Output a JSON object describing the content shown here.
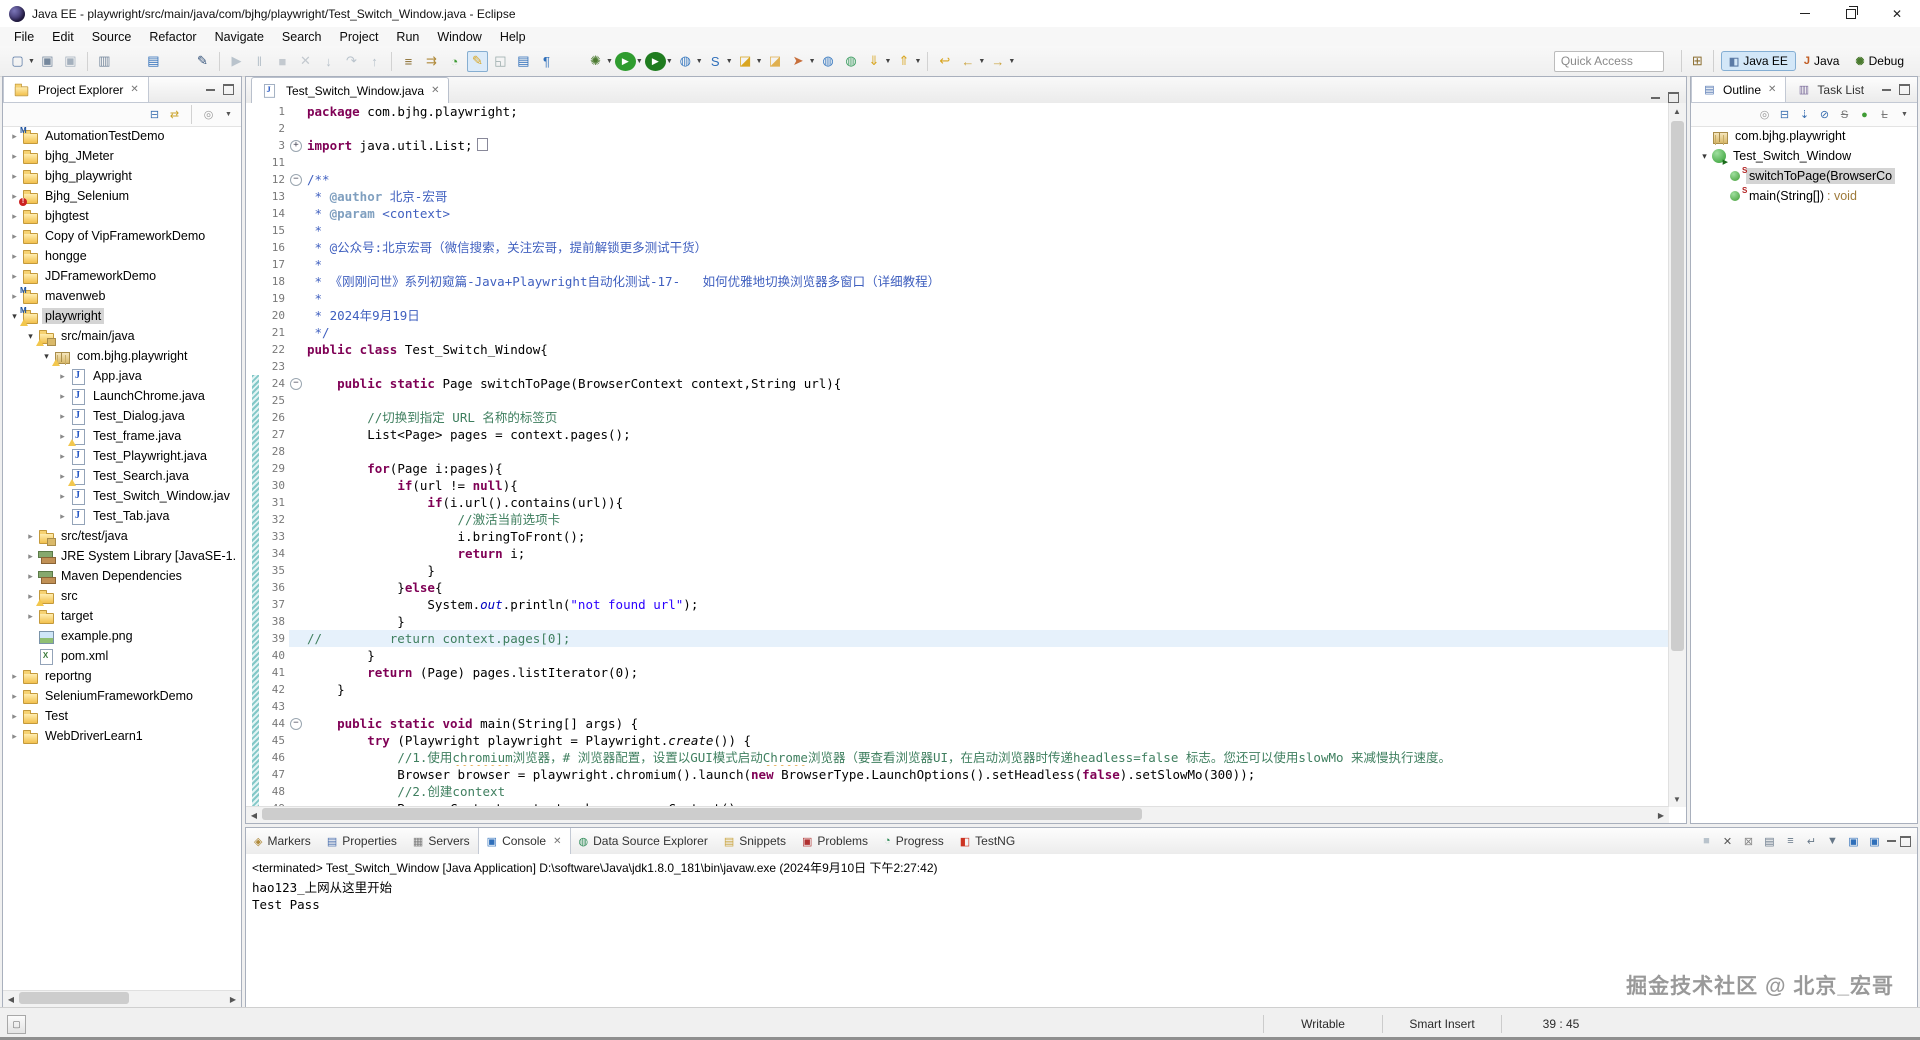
{
  "window": {
    "title": "Java EE - playwright/src/main/java/com/bjhg/playwright/Test_Switch_Window.java - Eclipse"
  },
  "menubar": {
    "items": [
      "File",
      "Edit",
      "Source",
      "Refactor",
      "Navigate",
      "Search",
      "Project",
      "Run",
      "Window",
      "Help"
    ]
  },
  "toolbar": {
    "quick_access_label": "Quick Access",
    "items": [
      "new-wizard*",
      "save",
      "save-all",
      "|",
      "print",
      "~",
      "open-element",
      "~",
      "mark-pen",
      "|",
      "resume",
      "suspend",
      "terminate",
      "disconnect",
      "step-into",
      "step-over",
      "step-return",
      "|",
      "step-filters",
      "clear-marks",
      "coverage-count",
      "highlighter!",
      "link-pair",
      "show-selected-element",
      "show-whitespace",
      "~",
      "debug*",
      "run*",
      "coverage*",
      "new-web-service*",
      "soap-monitor*",
      "open-folder*",
      "import-folder",
      "deploy*",
      "web-browser",
      "user-site",
      "download*",
      "upload*",
      "|",
      "last-edit-location",
      "back*",
      "forward*"
    ],
    "open_perspective_icon": "open-perspective",
    "perspectives": [
      {
        "label": "Java EE",
        "icon": "persp-javaee",
        "active": true
      },
      {
        "label": "Java",
        "icon": "persp-java",
        "active": false
      },
      {
        "label": "Debug",
        "icon": "persp-debug",
        "active": false
      }
    ]
  },
  "project_explorer": {
    "tab": "Project Explorer",
    "toolbar_icons": [
      "collapse-all",
      "link-with-editor",
      "|",
      "focus",
      "view-menu"
    ],
    "items": [
      {
        "d": 0,
        "a": ">",
        "icon": "fold",
        "badges": [
          "M"
        ],
        "label": "AutomationTestDemo"
      },
      {
        "d": 0,
        "a": ">",
        "icon": "fold",
        "badges": [],
        "label": "bjhg_JMeter"
      },
      {
        "d": 0,
        "a": ">",
        "icon": "fold",
        "badges": [],
        "label": "bjhg_playwright"
      },
      {
        "d": 0,
        "a": ">",
        "icon": "fold",
        "badges": [
          "E"
        ],
        "label": "Bjhg_Selenium"
      },
      {
        "d": 0,
        "a": ">",
        "icon": "fold",
        "badges": [],
        "label": "bjhgtest"
      },
      {
        "d": 0,
        "a": ">",
        "icon": "fold",
        "badges": [],
        "label": "Copy of VipFrameworkDemo"
      },
      {
        "d": 0,
        "a": ">",
        "icon": "fold",
        "badges": [],
        "label": "hongge"
      },
      {
        "d": 0,
        "a": ">",
        "icon": "fold",
        "badges": [],
        "label": "JDFrameworkDemo"
      },
      {
        "d": 0,
        "a": ">",
        "icon": "fold",
        "badges": [
          "M"
        ],
        "label": "mavenweb"
      },
      {
        "d": 0,
        "a": "v",
        "icon": "fold",
        "badges": [
          "M",
          "W"
        ],
        "label": "playwright",
        "sel": true
      },
      {
        "d": 1,
        "a": "v",
        "icon": "srcfold",
        "badges": [
          "W"
        ],
        "label": "src/main/java"
      },
      {
        "d": 2,
        "a": "v",
        "icon": "pkg",
        "badges": [
          "W"
        ],
        "label": "com.bjhg.playwright"
      },
      {
        "d": 3,
        "a": ">",
        "icon": "jf",
        "badges": [],
        "label": "App.java"
      },
      {
        "d": 3,
        "a": ">",
        "icon": "jf",
        "badges": [],
        "label": "LaunchChrome.java"
      },
      {
        "d": 3,
        "a": ">",
        "icon": "jf",
        "badges": [],
        "label": "Test_Dialog.java"
      },
      {
        "d": 3,
        "a": ">",
        "icon": "jf",
        "badges": [
          "W"
        ],
        "label": "Test_frame.java"
      },
      {
        "d": 3,
        "a": ">",
        "icon": "jf",
        "badges": [],
        "label": "Test_Playwright.java"
      },
      {
        "d": 3,
        "a": ">",
        "icon": "jf",
        "badges": [
          "W"
        ],
        "label": "Test_Search.java"
      },
      {
        "d": 3,
        "a": ">",
        "icon": "jf",
        "badges": [],
        "label": "Test_Switch_Window.jav"
      },
      {
        "d": 3,
        "a": ">",
        "icon": "jf",
        "badges": [],
        "label": "Test_Tab.java"
      },
      {
        "d": 1,
        "a": ">",
        "icon": "srcfold",
        "badges": [],
        "label": "src/test/java"
      },
      {
        "d": 1,
        "a": ">",
        "icon": "lib",
        "badges": [],
        "label": "JRE System Library [JavaSE-1."
      },
      {
        "d": 1,
        "a": ">",
        "icon": "lib",
        "badges": [],
        "label": "Maven Dependencies"
      },
      {
        "d": 1,
        "a": ">",
        "icon": "fold",
        "badges": [
          "W"
        ],
        "label": "src"
      },
      {
        "d": 1,
        "a": ">",
        "icon": "fold",
        "badges": [],
        "label": "target"
      },
      {
        "d": 1,
        "a": "",
        "icon": "img",
        "badges": [],
        "label": "example.png"
      },
      {
        "d": 1,
        "a": "",
        "icon": "xml",
        "badges": [],
        "label": "pom.xml"
      },
      {
        "d": 0,
        "a": ">",
        "icon": "fold",
        "badges": [],
        "label": "reportng"
      },
      {
        "d": 0,
        "a": ">",
        "icon": "fold",
        "badges": [],
        "label": "SeleniumFrameworkDemo"
      },
      {
        "d": 0,
        "a": ">",
        "icon": "fold",
        "badges": [],
        "label": "Test"
      },
      {
        "d": 0,
        "a": ">",
        "icon": "fold",
        "badges": [],
        "label": "WebDriverLearn1"
      }
    ]
  },
  "editor": {
    "tab_label": "Test_Switch_Window.java",
    "lines": [
      {
        "n": 1,
        "segs": [
          [
            "k",
            "package"
          ],
          [
            "p",
            " com.bjhg.playwright;"
          ]
        ]
      },
      {
        "n": 2,
        "segs": []
      },
      {
        "n": 3,
        "fold": "+",
        "segs": [
          [
            "k",
            "import"
          ],
          [
            "p",
            " java.util.List;"
          ],
          [
            "fb",
            ""
          ]
        ]
      },
      {
        "n": 11,
        "segs": []
      },
      {
        "n": 12,
        "fold": "-",
        "segs": [
          [
            "d",
            "/**"
          ]
        ]
      },
      {
        "n": 13,
        "segs": [
          [
            "d",
            " * "
          ],
          [
            "dt",
            "@author"
          ],
          [
            "d",
            " 北京-宏哥"
          ]
        ]
      },
      {
        "n": 14,
        "segs": [
          [
            "d",
            " * "
          ],
          [
            "dt",
            "@param"
          ],
          [
            "d",
            " <context>"
          ]
        ]
      },
      {
        "n": 15,
        "segs": [
          [
            "d",
            " *"
          ]
        ]
      },
      {
        "n": 16,
        "segs": [
          [
            "d",
            " * @公众号:北京宏哥（微信搜索，关注宏哥，提前解锁更多测试干货）"
          ]
        ]
      },
      {
        "n": 17,
        "segs": [
          [
            "d",
            " *"
          ]
        ]
      },
      {
        "n": 18,
        "segs": [
          [
            "d",
            " * 《刚刚问世》系列初窥篇-Java+Playwright自动化测试-17-   如何优雅地切换浏览器多窗口（详细教程）"
          ]
        ]
      },
      {
        "n": 19,
        "segs": [
          [
            "d",
            " *"
          ]
        ]
      },
      {
        "n": 20,
        "segs": [
          [
            "d",
            " * 2024年9月19日"
          ]
        ]
      },
      {
        "n": 21,
        "segs": [
          [
            "d",
            " */"
          ]
        ]
      },
      {
        "n": 22,
        "segs": [
          [
            "k",
            "public class"
          ],
          [
            "p",
            " Test_Switch_Window{"
          ]
        ]
      },
      {
        "n": 23,
        "segs": []
      },
      {
        "n": 24,
        "fold": "-",
        "ch": 1,
        "segs": [
          [
            "p",
            "    "
          ],
          [
            "k",
            "public static"
          ],
          [
            "p",
            " Page switchToPage(BrowserContext context,String url){"
          ]
        ]
      },
      {
        "n": 25,
        "ch": 1,
        "segs": []
      },
      {
        "n": 26,
        "ch": 1,
        "segs": [
          [
            "p",
            "        "
          ],
          [
            "c",
            "//切换到指定 URL 名称的标签页"
          ]
        ]
      },
      {
        "n": 27,
        "ch": 1,
        "segs": [
          [
            "p",
            "        List<Page> pages = context.pages();"
          ]
        ]
      },
      {
        "n": 28,
        "ch": 1,
        "segs": []
      },
      {
        "n": 29,
        "ch": 1,
        "segs": [
          [
            "p",
            "        "
          ],
          [
            "k",
            "for"
          ],
          [
            "p",
            "(Page i:pages){"
          ]
        ]
      },
      {
        "n": 30,
        "ch": 1,
        "segs": [
          [
            "p",
            "            "
          ],
          [
            "k",
            "if"
          ],
          [
            "p",
            "(url != "
          ],
          [
            "k",
            "null"
          ],
          [
            "p",
            "){"
          ]
        ]
      },
      {
        "n": 31,
        "ch": 1,
        "segs": [
          [
            "p",
            "                "
          ],
          [
            "k",
            "if"
          ],
          [
            "p",
            "(i.url().contains(url)){"
          ]
        ]
      },
      {
        "n": 32,
        "ch": 1,
        "segs": [
          [
            "p",
            "                    "
          ],
          [
            "c",
            "//激活当前选项卡"
          ]
        ]
      },
      {
        "n": 33,
        "ch": 1,
        "segs": [
          [
            "p",
            "                    i.bringToFront();"
          ]
        ]
      },
      {
        "n": 34,
        "ch": 1,
        "segs": [
          [
            "p",
            "                    "
          ],
          [
            "k",
            "return"
          ],
          [
            "p",
            " i;"
          ]
        ]
      },
      {
        "n": 35,
        "ch": 1,
        "segs": [
          [
            "p",
            "                }"
          ]
        ]
      },
      {
        "n": 36,
        "ch": 1,
        "segs": [
          [
            "p",
            "            }"
          ],
          [
            "k",
            "else"
          ],
          [
            "p",
            "{"
          ]
        ]
      },
      {
        "n": 37,
        "ch": 1,
        "segs": [
          [
            "p",
            "                System."
          ],
          [
            "f",
            "out"
          ],
          [
            "p",
            ".println("
          ],
          [
            "s",
            "\"not found url\""
          ],
          [
            "p",
            ");"
          ]
        ]
      },
      {
        "n": 38,
        "ch": 1,
        "segs": [
          [
            "p",
            "            }"
          ]
        ]
      },
      {
        "n": 39,
        "ch": 1,
        "hl": 1,
        "segs": [
          [
            "c",
            "//         return context.pages[0];"
          ]
        ]
      },
      {
        "n": 40,
        "ch": 1,
        "segs": [
          [
            "p",
            "        }"
          ]
        ]
      },
      {
        "n": 41,
        "ch": 1,
        "segs": [
          [
            "p",
            "        "
          ],
          [
            "k",
            "return"
          ],
          [
            "p",
            " (Page) pages.listIterator(0);"
          ]
        ]
      },
      {
        "n": 42,
        "ch": 1,
        "segs": [
          [
            "p",
            "    }"
          ]
        ]
      },
      {
        "n": 43,
        "ch": 1,
        "segs": []
      },
      {
        "n": 44,
        "fold": "-",
        "ch": 1,
        "segs": [
          [
            "p",
            "    "
          ],
          [
            "k",
            "public static void"
          ],
          [
            "p",
            " main(String[] args) {"
          ]
        ]
      },
      {
        "n": 45,
        "ch": 1,
        "segs": [
          [
            "p",
            "        "
          ],
          [
            "k",
            "try"
          ],
          [
            "p",
            " (Playwright playwright = Playwright."
          ],
          [
            "st",
            "create"
          ],
          [
            "p",
            "()) {"
          ]
        ]
      },
      {
        "n": 46,
        "ch": 1,
        "segs": [
          [
            "p",
            "            "
          ],
          [
            "c",
            "//1.使用"
          ],
          [
            "cu",
            "chromium"
          ],
          [
            "c",
            "浏览器，# 浏览器配置，设置以GUI模式启动"
          ],
          [
            "cu",
            "Chrome"
          ],
          [
            "c",
            "浏览器（要查看浏览器UI，在启动浏览器时传递headless=false 标志。您还可以使用slowMo 来减慢执行速度。"
          ]
        ]
      },
      {
        "n": 47,
        "ch": 1,
        "segs": [
          [
            "p",
            "            Browser browser = playwright.chromium().launch("
          ],
          [
            "k",
            "new"
          ],
          [
            "p",
            " BrowserType.LaunchOptions().setHeadless("
          ],
          [
            "k",
            "false"
          ],
          [
            "p",
            ").setSlowMo(300));"
          ]
        ]
      },
      {
        "n": 48,
        "ch": 1,
        "segs": [
          [
            "p",
            "            "
          ],
          [
            "c",
            "//2.创建context"
          ]
        ]
      },
      {
        "n": 49,
        "ch": 1,
        "segs": [
          [
            "p",
            "            BrowserContext context = browser.newContext();"
          ]
        ]
      }
    ]
  },
  "outline": {
    "tab": "Outline",
    "tab2": "Task List",
    "toolbar_icons": [
      "focus",
      "collapse-all",
      "sort",
      "hide-fields",
      "hide-static",
      "show-public",
      "hide-local-types",
      "view-menu"
    ],
    "items": [
      {
        "d": 0,
        "a": "",
        "icon": "pkg",
        "label": "com.bjhg.playwright",
        "sel": false
      },
      {
        "d": 0,
        "a": "v",
        "icon": "cls",
        "label": "Test_Switch_Window",
        "sel": false
      },
      {
        "d": 1,
        "a": "",
        "icon": "mth",
        "label": "switchToPage(BrowserCo",
        "sel": true,
        "suffix": ""
      },
      {
        "d": 1,
        "a": "",
        "icon": "mth",
        "label": "main(String[])",
        "sel": false,
        "suffix": " : void"
      }
    ]
  },
  "console": {
    "tabs": [
      {
        "label": "Markers",
        "icon": "markers",
        "active": false
      },
      {
        "label": "Properties",
        "icon": "properties",
        "active": false
      },
      {
        "label": "Servers",
        "icon": "servers",
        "active": false
      },
      {
        "label": "Console",
        "icon": "console",
        "active": true,
        "closable": true
      },
      {
        "label": "Data Source Explorer",
        "icon": "dse",
        "active": false
      },
      {
        "label": "Snippets",
        "icon": "snippets",
        "active": false
      },
      {
        "label": "Problems",
        "icon": "problems",
        "active": false
      },
      {
        "label": "Progress",
        "icon": "progress",
        "active": false
      },
      {
        "label": "TestNG",
        "icon": "testng",
        "active": false
      }
    ],
    "toolbar_icons": [
      "terminate-console",
      "remove-launch",
      "remove-all-launches",
      "clear-console",
      "scroll-lock",
      "word-wrap",
      "pin-console",
      "display-selected-console",
      "open-console"
    ],
    "header": "<terminated> Test_Switch_Window [Java Application] D:\\software\\Java\\jdk1.8.0_181\\bin\\javaw.exe (2024年9月10日 下午2:27:42)",
    "output": [
      "hao123_上网从这里开始",
      "Test Pass"
    ]
  },
  "status_bar": {
    "writable": "Writable",
    "insert_mode": "Smart Insert",
    "position": "39 : 45"
  },
  "watermark": "掘金技术社区 @ 北京_宏哥"
}
